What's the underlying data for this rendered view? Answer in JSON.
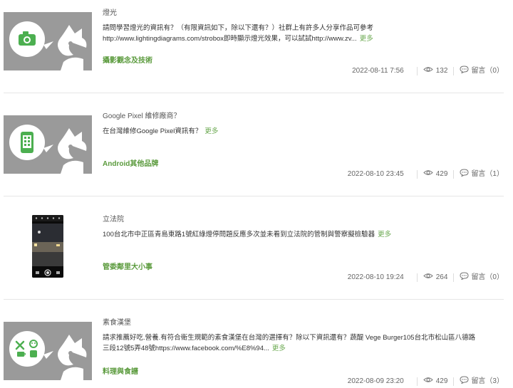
{
  "posts": [
    {
      "title": "燈光",
      "desc_line1": "請問學習燈光的資訊有？（有限資訊如下，除以下還有？）社群上有許多人分享作品可參考",
      "desc_line2": "http://www.lightingdiagrams.com/strobox即時顯示燈光效果，可以試試http://www.zv...",
      "more": "更多",
      "category": "攝影觀念及技術",
      "date": "2022-08-11 7:56",
      "views": "132",
      "comments": "留言（0）",
      "icon": "camera-icon"
    },
    {
      "title": "Google Pixel 維修廠商？",
      "desc_line1": "在台灣維修Google Pixel資訊有？",
      "desc_line2": "",
      "more": "更多",
      "category": "Android其他品牌",
      "date": "2022-08-10 23:45",
      "views": "429",
      "comments": "留言（1）",
      "icon": "phone-icon"
    },
    {
      "title": "立法院",
      "desc_line1": "100台北市中正區青島東路1號紅綠燈停問題反應多次並未看到立法院的管制與警察擬檢驗器",
      "desc_line2": "",
      "more": "更多",
      "category": "管委鄰里大小事",
      "date": "2022-08-10 19:24",
      "views": "264",
      "comments": "留言（0）",
      "icon": "photo"
    },
    {
      "title": "素食漢堡",
      "desc_line1": "請求推薦好吃.營養.有符合衛生規範的素食漢堡在台灣的選擇有？除以下資訊還有？蔬醍 Vege Burger105台北市松山區八德路",
      "desc_line2": "三段12號5弄48號https://www.facebook.com/%E8%94...",
      "more": "更多",
      "category": "料理與食譜",
      "date": "2022-08-09 23:20",
      "views": "429",
      "comments": "留言（3）",
      "icon": "food-icon"
    }
  ]
}
